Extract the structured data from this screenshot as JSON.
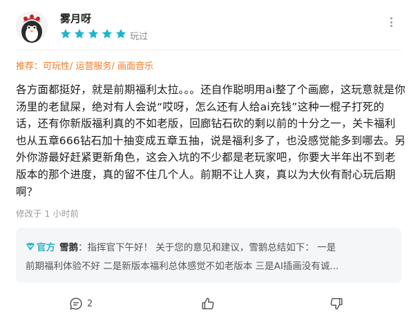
{
  "user": {
    "name": "雾月呀",
    "rating_stars": 5,
    "rating_max": 5,
    "played_label": "玩过"
  },
  "recommend": {
    "text": "推荐：可玩性/ 运营服务/ 画面音乐"
  },
  "review": {
    "body": "各方面都挺好，就是前期福利太拉。。。还自作聪明用ai整了个画廊，这玩意就是你汤里的老鼠屎，绝对有人会说“哎呀，怎么还有人给ai充钱”这种一棍子打死的话，还有你新版福利真的不如老版，回廊钻石砍的剩以前的十分之一，关卡福利也从五章666钻石加十抽变成五章五抽，说是福利多了，也没感觉能多到哪去。另外你游最好赶紧更新角色，这会入坑的不少都是老玩家吧，你要大半年出不到老版本的那个进度，真的留不住几个人。前期不让人爽，真以为大伙有耐心玩后期啊？",
    "edited": "修改于 1 小时前"
  },
  "official_reply": {
    "badge": "官方",
    "author": "雪鹅",
    "line1": "：指挥官下午好！ 关于您的意见和建议，雪鹅总结如下： 一是",
    "line2": "前期福利体验不好 二是新版本福利总体感觉不如老版本 三是AI插画没有诚..."
  },
  "actions": {
    "comment_count": "2"
  },
  "colors": {
    "star": "#1cb8c9",
    "accent_orange": "#f07a26",
    "official_teal": "#2ab4c9"
  }
}
